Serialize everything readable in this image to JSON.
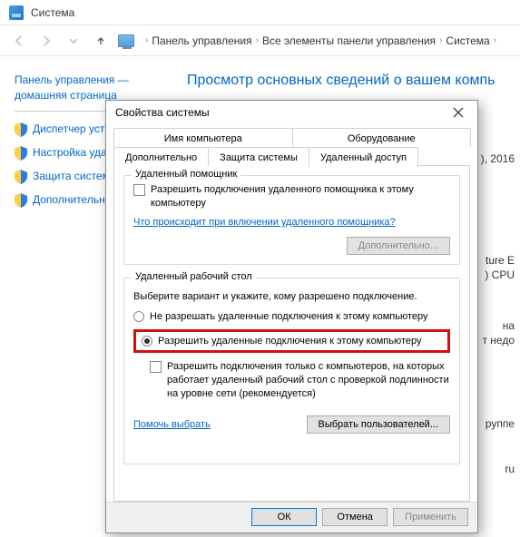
{
  "window": {
    "title": "Система"
  },
  "breadcrumb": {
    "items": [
      "Панель управления",
      "Все элементы панели управления",
      "Система"
    ]
  },
  "sidebar": {
    "home": "Панель управления — домашняя страница",
    "items": [
      "Диспетчер устр",
      "Настройка удал доступа",
      "Защита систем",
      "Дополнительнь системы"
    ]
  },
  "main": {
    "heading": "Просмотр основных сведений о вашем компь"
  },
  "fragments": {
    "year": "), 2016",
    "cpu1": "ture E",
    "cpu2": ") CPU",
    "ram": "на",
    "ramnote": "т недо",
    "group": "руппе",
    "ru": "ru"
  },
  "dialog": {
    "title": "Свойства системы",
    "tabs_row1": [
      "Имя компьютера",
      "Оборудование"
    ],
    "tabs_row2": [
      "Дополнительно",
      "Защита системы",
      "Удаленный доступ"
    ],
    "group1": {
      "label": "Удаленный помощник",
      "checkbox": "Разрешить подключения удаленного помощника к этому компьютеру",
      "link": "Что происходит при включении удаленного помощника?",
      "button": "Дополнительно..."
    },
    "group2": {
      "label": "Удаленный рабочий стол",
      "desc": "Выберите вариант и укажите, кому разрешено подключение.",
      "radio_deny": "Не разрешать удаленные подключения к этому компьютеру",
      "radio_allow": "Разрешить удаленные подключения к этому компьютеру",
      "nla_checkbox": "Разрешить подключения только с компьютеров, на которых работает удаленный рабочий стол с проверкой подлинности на уровне сети (рекомендуется)",
      "help_link": "Помочь выбрать",
      "users_button": "Выбрать пользователей..."
    },
    "buttons": {
      "ok": "ОК",
      "cancel": "Отмена",
      "apply": "Применить"
    }
  }
}
